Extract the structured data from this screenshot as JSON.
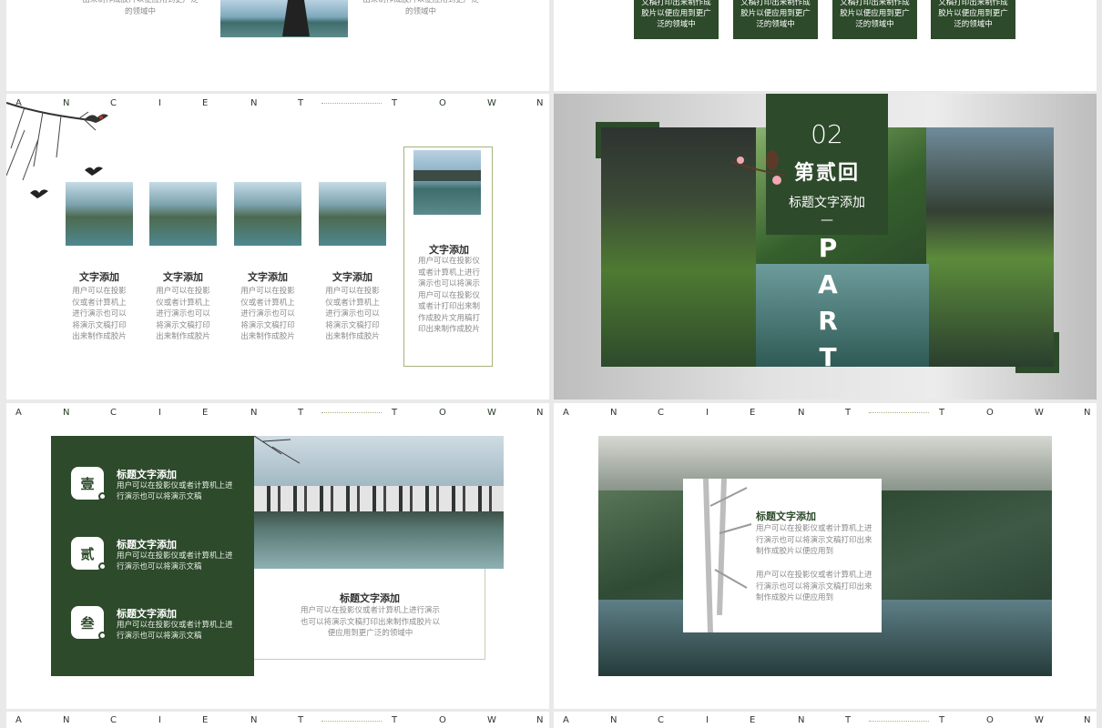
{
  "brand_colors": {
    "accent": "#2d4a2b",
    "line": "#a7b37d"
  },
  "header_letters": [
    "A",
    "N",
    "C",
    "I",
    "E",
    "N",
    "T",
    "T",
    "O",
    "W",
    "N"
  ],
  "slide1": {
    "text_left": "出来制作成胶片以便应用到更广泛的领域中",
    "text_right": "出来制作成胶片以便应用到更广泛的领域中"
  },
  "slide2": {
    "boxes": [
      "文稿打印出来制作成胶片以便应用到更广泛的领域中",
      "文稿打印出来制作成胶片以便应用到更广泛的领域中",
      "文稿打印出来制作成胶片以便应用到更广泛的领域中",
      "文稿打印出来制作成胶片以便应用到更广泛的领域中"
    ]
  },
  "slide3": {
    "items": [
      {
        "title": "文字添加",
        "body": "用户可以在投影仪或者计算机上进行演示也可以将演示文稿打印出来制作成胶片"
      },
      {
        "title": "文字添加",
        "body": "用户可以在投影仪或者计算机上进行演示也可以将演示文稿打印出来制作成胶片"
      },
      {
        "title": "文字添加",
        "body": "用户可以在投影仪或者计算机上进行演示也可以将演示文稿打印出来制作成胶片"
      },
      {
        "title": "文字添加",
        "body": "用户可以在投影仪或者计算机上进行演示也可以将演示文稿打印出来制作成胶片"
      }
    ],
    "card": {
      "title": "文字添加",
      "body": "用户可以在投影仪或者计算机上进行演示也可以将演示用户可以在投影仪或者计打印出来制作成胶片文用稿打印出来制作成胶片"
    }
  },
  "slide4": {
    "num": "02",
    "chapter": "第贰回",
    "subtitle": "标题文字添加",
    "dash": "—",
    "vertical": "PART"
  },
  "slide5": {
    "items": [
      {
        "badge": "壹",
        "title": "标题文字添加",
        "body": "用户可以在投影仪或者计算机上进行演示也可以将演示文稿"
      },
      {
        "badge": "贰",
        "title": "标题文字添加",
        "body": "用户可以在投影仪或者计算机上进行演示也可以将演示文稿"
      },
      {
        "badge": "叁",
        "title": "标题文字添加",
        "body": "用户可以在投影仪或者计算机上进行演示也可以将演示文稿"
      }
    ],
    "card": {
      "title": "标题文字添加",
      "body": "用户可以在投影仪或者计算机上进行演示也可以将演示文稿打印出来制作成胶片以便应用到更广泛的领域中"
    }
  },
  "slide6": {
    "title": "标题文字添加",
    "p1": "用户可以在投影仪或者计算机上进行演示也可以将演示文稿打印出来制作成胶片以便应用到",
    "p2": "用户可以在投影仪或者计算机上进行演示也可以将演示文稿打印出来制作成胶片以便应用到"
  }
}
